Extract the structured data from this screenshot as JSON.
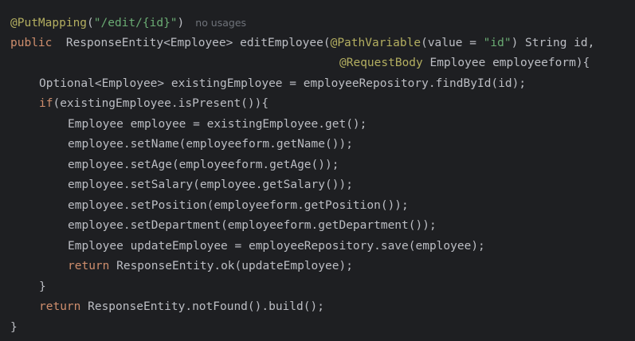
{
  "code": {
    "l1": {
      "annotation": "@PutMapping",
      "open": "(",
      "path": "\"/edit/{id}\"",
      "close": ")",
      "hint": "no usages"
    },
    "l2": {
      "kw": "public",
      "sig1": "  ResponseEntity<Employee> editEmployee(",
      "ann": "@PathVariable",
      "mid": "(value = ",
      "str": "\"id\"",
      "end": ") String id,"
    },
    "l3": {
      "ann": "@RequestBody",
      "rest": " Employee employeeform){"
    },
    "l4": {
      "text": "Optional<Employee> existingEmployee = employeeRepository.findById(id);"
    },
    "l5": {
      "kw": "if",
      "rest": "(existingEmployee.isPresent()){"
    },
    "l6": {
      "text": "Employee employee = existingEmployee.get();"
    },
    "l7": {
      "text": "employee.setName(employeeform.getName());"
    },
    "l8": {
      "text": "employee.setAge(employeeform.getAge());"
    },
    "l9": {
      "text": "employee.setSalary(employee.getSalary());"
    },
    "l10": {
      "text": "employee.setPosition(employeeform.getPosition());"
    },
    "l11": {
      "text": "employee.setDepartment(employeeform.getDepartment());"
    },
    "l12": {
      "text": "Employee updateEmployee = employeeRepository.save(employee);"
    },
    "l13": {
      "kw": "return",
      "rest": " ResponseEntity.ok(updateEmployee);"
    },
    "l14": {
      "text": "}"
    },
    "l15": {
      "kw": "return",
      "rest": " ResponseEntity.notFound().build();"
    },
    "l16": {
      "text": "}"
    }
  },
  "colors": {
    "background": "#1e1f22",
    "text": "#bcbec4",
    "annotation": "#b3ae60",
    "keyword": "#cf8e6d",
    "string": "#6aab73",
    "hint": "#6f737a"
  }
}
